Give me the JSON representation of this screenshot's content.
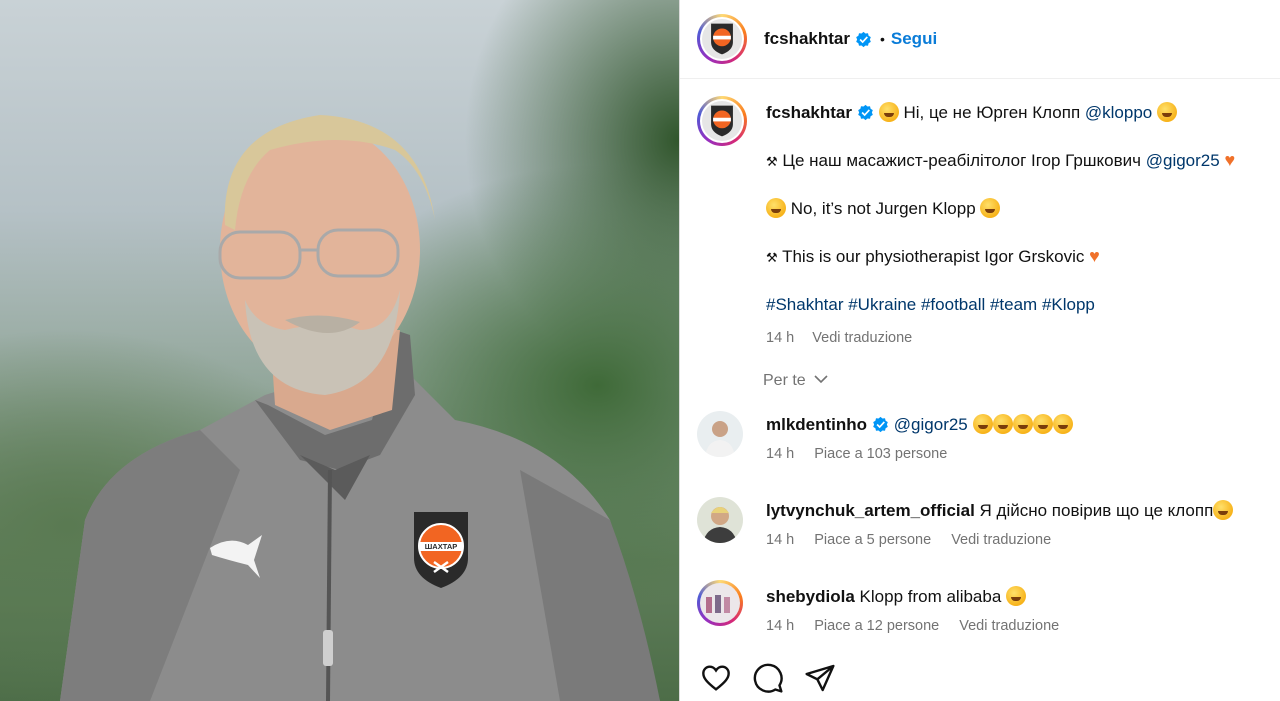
{
  "header": {
    "username": "fcshakhtar",
    "separator": "•",
    "follow_label": "Segui"
  },
  "caption": {
    "username": "fcshakhtar",
    "line1": "Ні, це не Юрген Клопп",
    "line1_mention": "@kloppo",
    "line2": "Це наш масажист-реабілітолог Ігор Гршкович",
    "line2_mention": "@gigor25",
    "line3": "No, it’s not Jurgen Klopp",
    "line4": "This is our physiotherapist Igor Grskovic",
    "hashtags": "#Shakhtar #Ukraine #football #team #Klopp",
    "time": "14 h",
    "translate": "Vedi traduzione"
  },
  "for_you_label": "Per te",
  "comments": [
    {
      "username": "mlkdentinho",
      "verified": true,
      "mention": "@gigor25",
      "text": "",
      "time": "14 h",
      "likes": "Piace a 103 persone",
      "translate": ""
    },
    {
      "username": "lytvynchuk_artem_official",
      "verified": false,
      "mention": "",
      "text": "Я дійсно повірив що це клопп",
      "time": "14 h",
      "likes": "Piace a 5 persone",
      "translate": "Vedi traduzione"
    },
    {
      "username": "shebydiola",
      "verified": false,
      "mention": "",
      "text": "Klopp from alibaba",
      "time": "14 h",
      "likes": "Piace a 12 persone",
      "translate": "Vedi traduzione"
    }
  ],
  "crest_text": "ШАХТАР",
  "colors": {
    "link": "#0a7cd8",
    "mention": "#00376b",
    "muted": "#737373",
    "crest_orange": "#f26522"
  },
  "icons": [
    "verified-badge-icon",
    "heart-icon",
    "comment-icon",
    "share-icon",
    "chevron-down-icon"
  ]
}
